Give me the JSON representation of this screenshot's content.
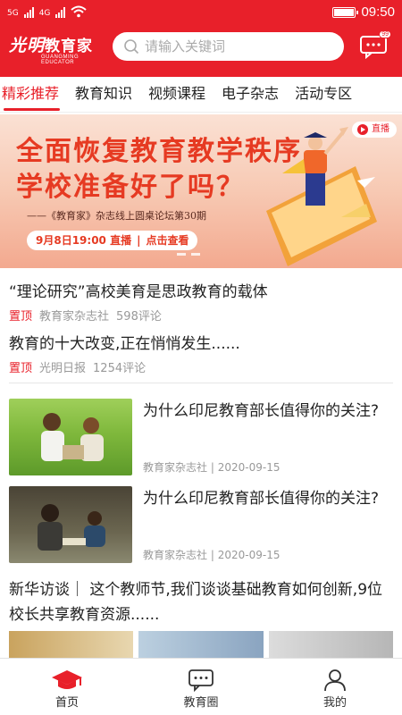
{
  "status": {
    "sig1": "5G",
    "sig2": "4G",
    "time": "09:50"
  },
  "header": {
    "logo_cn": "光明",
    "logo_cn2": "教育家",
    "logo_en": "GUANGMING EDUCATOR",
    "search_placeholder": "请输入关键词",
    "msg_badge": "99"
  },
  "tabs": [
    {
      "label": "精彩推荐"
    },
    {
      "label": "教育知识"
    },
    {
      "label": "视频课程"
    },
    {
      "label": "电子杂志"
    },
    {
      "label": "活动专区"
    }
  ],
  "banner": {
    "line1": "全面恢复教育教学秩序",
    "line2": "学校准备好了吗？",
    "subtitle": "——《教育家》杂志线上圆桌论坛第30期",
    "live_time": "9月8日19:00 直播",
    "live_sep": "|",
    "live_action": "点击查看",
    "tag": "直播"
  },
  "articles": [
    {
      "title": "“理论研究”高校美育是思政教育的载体",
      "pin": "置顶",
      "source": "教育家杂志社",
      "comments": "598评论"
    },
    {
      "title": "教育的十大改变,正在悄悄发生......",
      "pin": "置顶",
      "source": "光明日报",
      "comments": "1254评论"
    }
  ],
  "image_articles": [
    {
      "title": "为什么印尼教育部长值得你的关注?",
      "source": "教育家杂志社",
      "sep": "|",
      "date": "2020-09-15"
    },
    {
      "title": "为什么印尼教育部长值得你的关注?",
      "source": "教育家杂志社",
      "sep": "|",
      "date": "2020-09-15"
    }
  ],
  "long_article": {
    "title": "新华访谈｜ 这个教师节,我们谈谈基础教育如何创新,9位校长共享教育资源......"
  },
  "bottom_nav": [
    {
      "label": "首页"
    },
    {
      "label": "教育圈"
    },
    {
      "label": "我的"
    }
  ],
  "colors": {
    "brand": "#e8202a",
    "banner_text": "#e63a22"
  }
}
